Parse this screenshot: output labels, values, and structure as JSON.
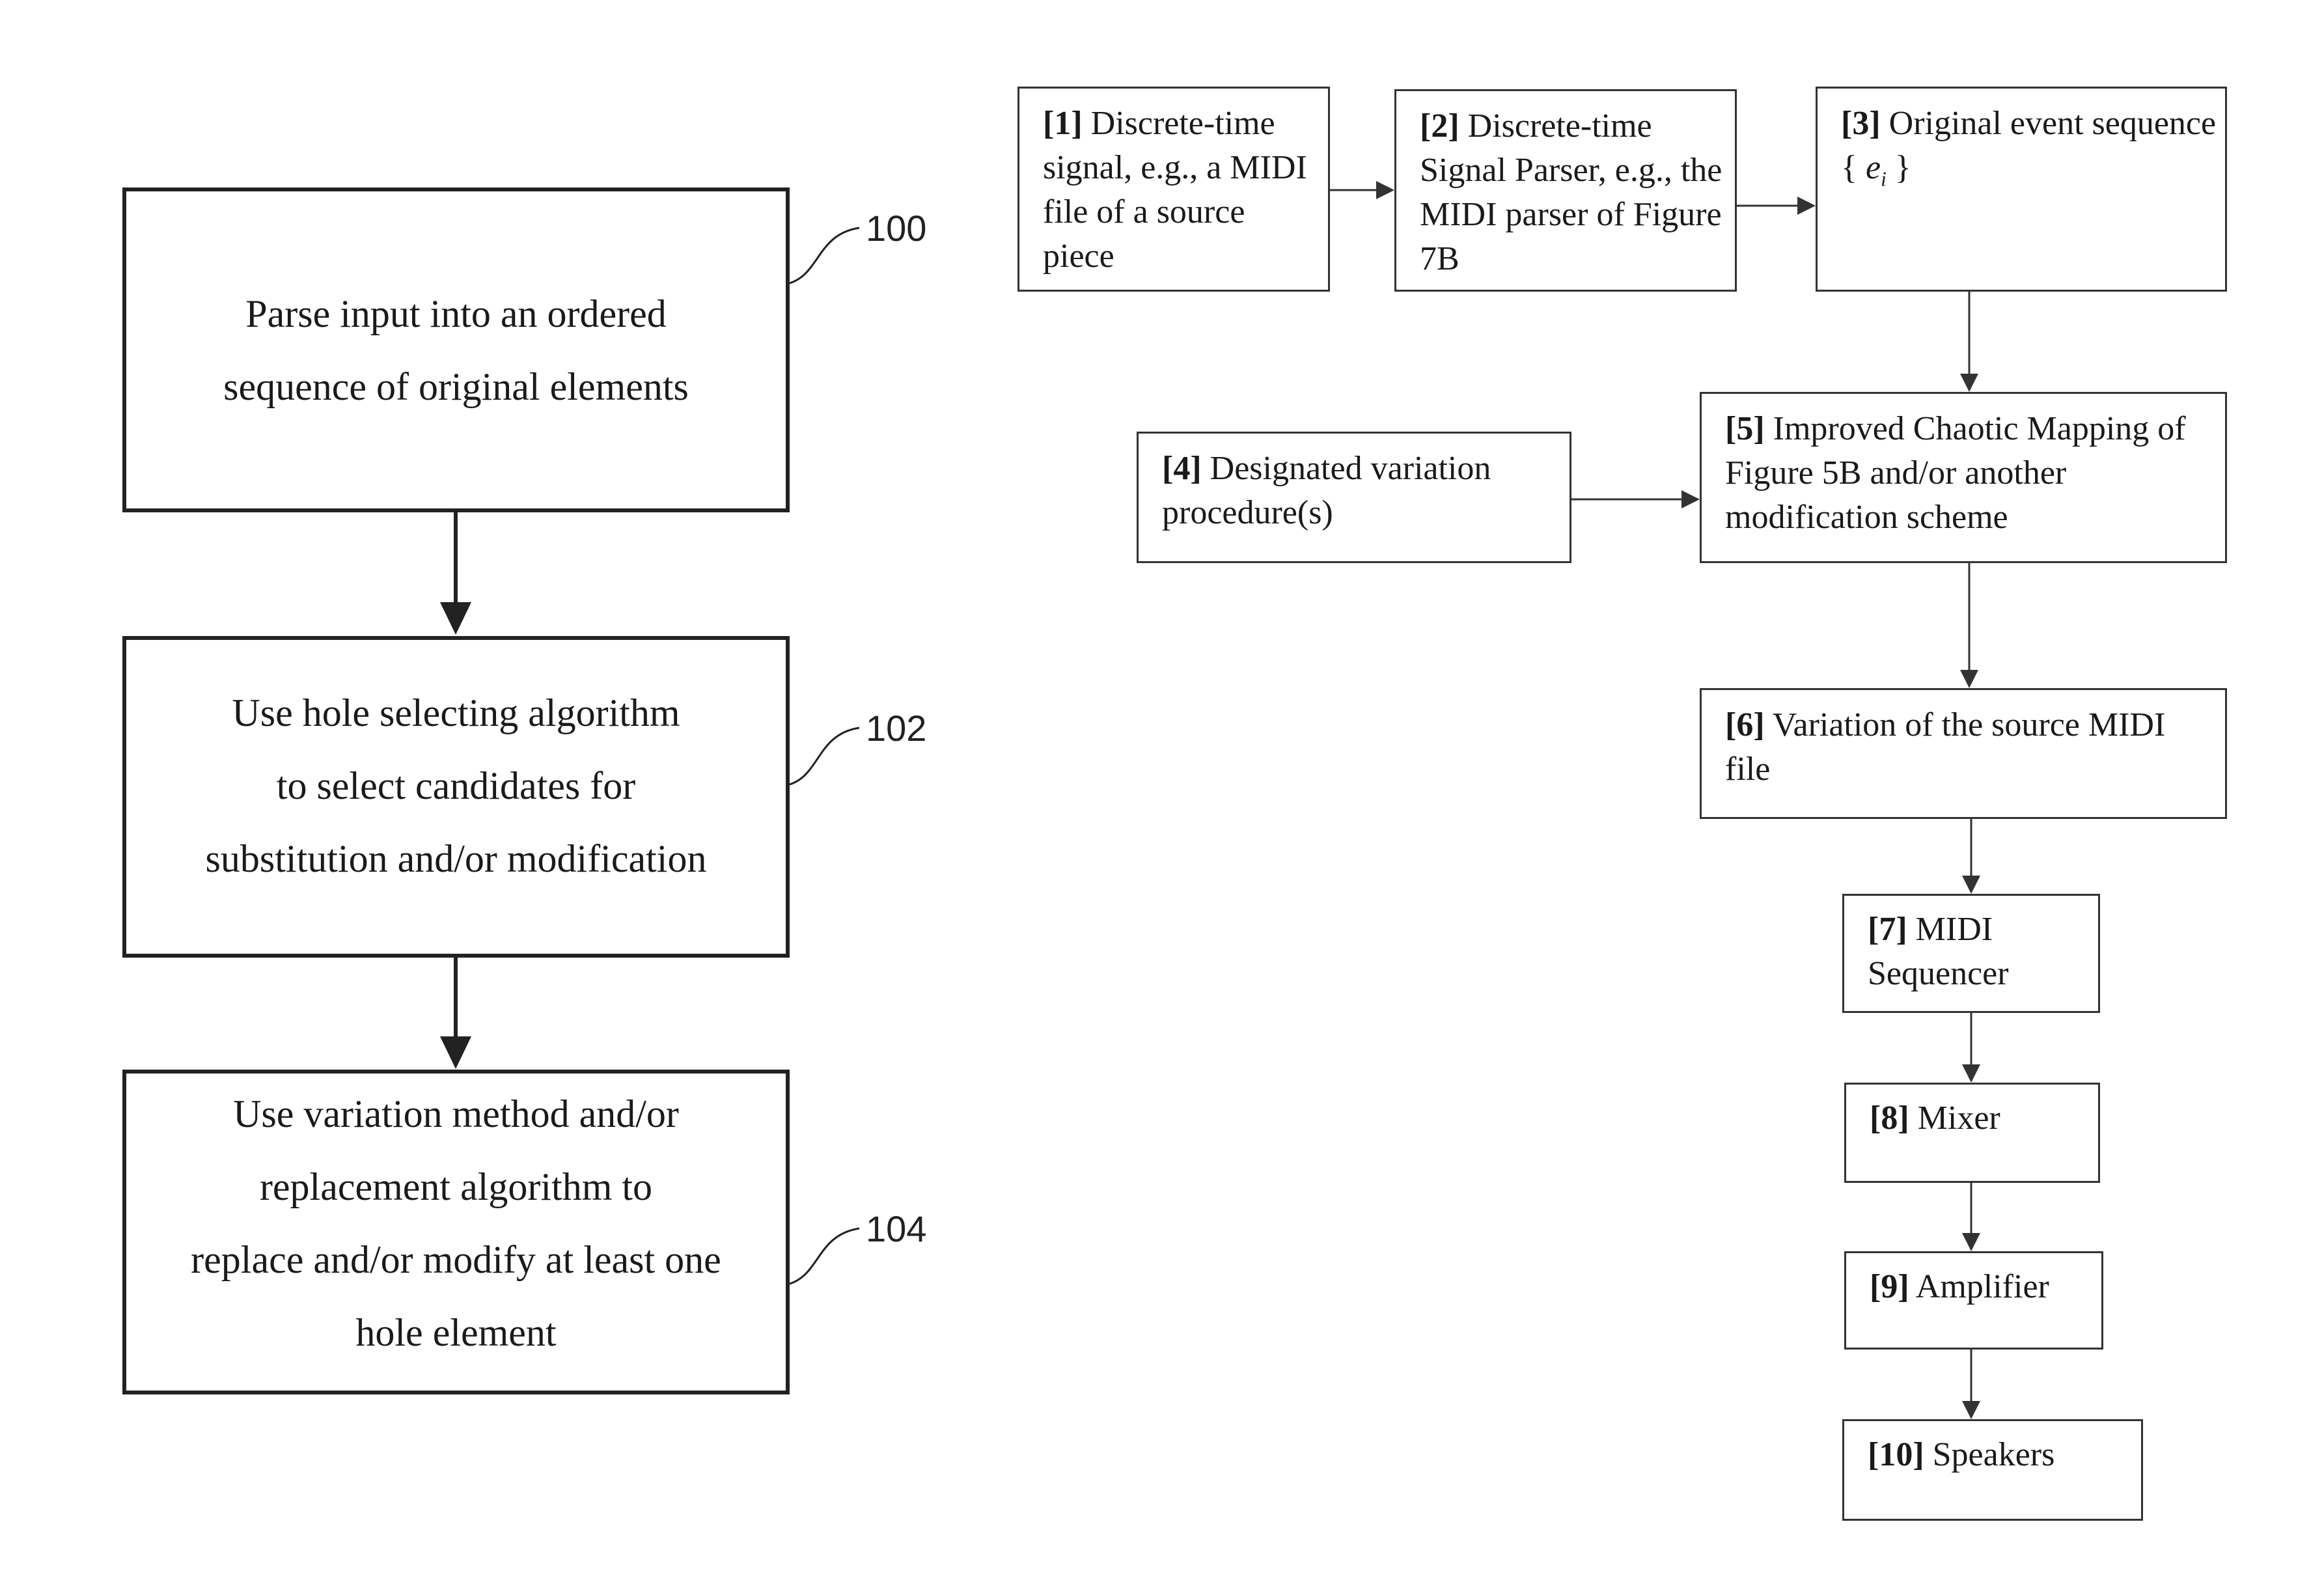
{
  "left_flow": {
    "steps": [
      {
        "ref": "100",
        "lines": [
          "Parse input into an ordered",
          "sequence of original elements"
        ]
      },
      {
        "ref": "102",
        "lines": [
          "Use hole selecting algorithm",
          "to select candidates for",
          "substitution and/or modification"
        ]
      },
      {
        "ref": "104",
        "lines": [
          "Use variation method and/or",
          "replacement algorithm to",
          "replace and/or modify at least one",
          "hole element"
        ]
      }
    ]
  },
  "right_flow": {
    "blocks": [
      {
        "num": "[1]",
        "text": "Discrete-time signal, e.g., a MIDI file of a source piece"
      },
      {
        "num": "[2]",
        "text": "Discrete-time Signal Parser, e.g., the MIDI parser of Figure 7B"
      },
      {
        "num": "[3]",
        "text": "Original event sequence",
        "symbol_base": "e",
        "symbol_sub": "i"
      },
      {
        "num": "[4]",
        "text": "Designated variation procedure(s)"
      },
      {
        "num": "[5]",
        "text": "Improved Chaotic Mapping of Figure 5B and/or another modification scheme"
      },
      {
        "num": "[6]",
        "text": "Variation of the source MIDI file"
      },
      {
        "num": "[7]",
        "text": "MIDI Sequencer"
      },
      {
        "num": "[8]",
        "text": "Mixer"
      },
      {
        "num": "[9]",
        "text": "Amplifier"
      },
      {
        "num": "[10]",
        "text": "Speakers"
      }
    ]
  }
}
